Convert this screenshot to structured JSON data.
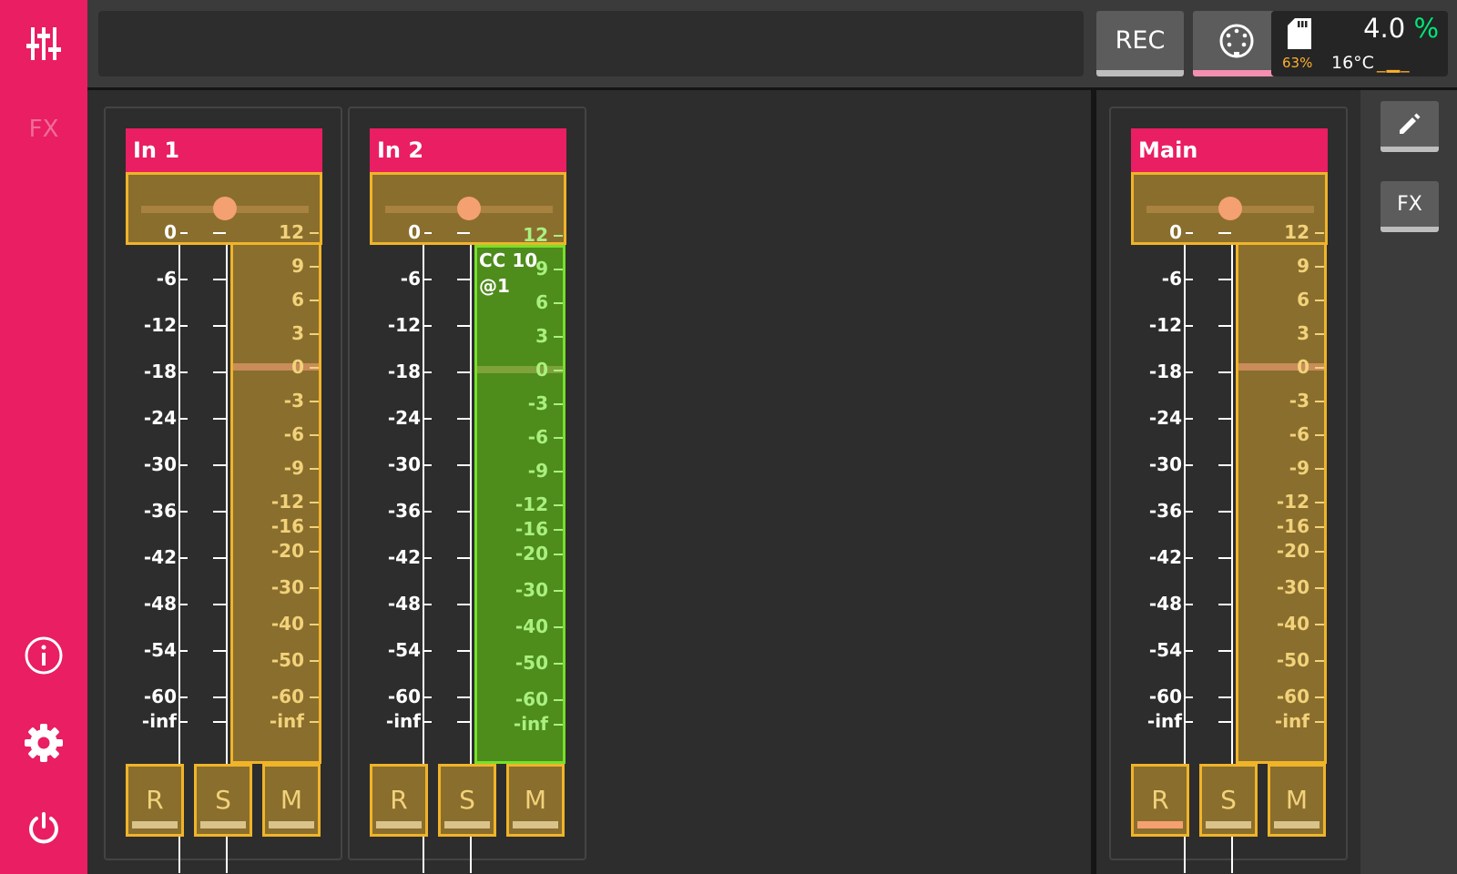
{
  "sidebar": {
    "fx_label": "FX"
  },
  "topbar": {
    "rec_label": "REC",
    "sd_percent": "63%",
    "cpu_value": "4.0",
    "cpu_unit": "%",
    "temperature": "16°C",
    "temp_bars": "_▁_"
  },
  "toolbar": {
    "fx_label": "FX"
  },
  "db_scale": [
    "0",
    "-6",
    "-12",
    "-18",
    "-24",
    "-30",
    "-36",
    "-42",
    "-48",
    "-54",
    "-60",
    "-inf"
  ],
  "fader_scale": [
    "12",
    "9",
    "6",
    "3",
    "0",
    "-3",
    "-6",
    "-9",
    "-12",
    "-16",
    "-20",
    "-30",
    "-40",
    "-50",
    "-60",
    "-inf"
  ],
  "channels": [
    {
      "name": "In 1",
      "cc_label": "",
      "active": false,
      "rec_armed": false,
      "pan": 0.5,
      "buttons": {
        "r": "R",
        "s": "S",
        "m": "M"
      }
    },
    {
      "name": "In 2",
      "cc_label": "CC 10 @1",
      "active": true,
      "rec_armed": false,
      "pan": 0.5,
      "buttons": {
        "r": "R",
        "s": "S",
        "m": "M"
      }
    },
    {
      "name": "Main",
      "cc_label": "",
      "active": false,
      "rec_armed": true,
      "pan": 0.5,
      "buttons": {
        "r": "R",
        "s": "S",
        "m": "M"
      }
    }
  ],
  "colors": {
    "accent": "#e91e63",
    "fader_bg": "#8a6e2e",
    "fader_border": "#f0b429",
    "active_fader_bg": "#4e8c1c",
    "cpu_unit": "#00e676",
    "sd_text": "#ffb02e"
  }
}
